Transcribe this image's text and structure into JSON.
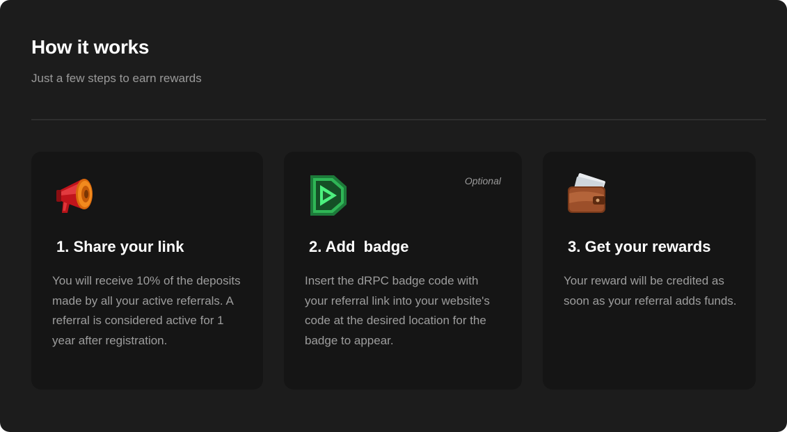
{
  "section": {
    "title": "How it works",
    "subtitle": "Just a few steps to earn rewards"
  },
  "steps": [
    {
      "number": "1.",
      "title": "Share your link",
      "body": "You will receive 10% of the deposits made by all your active referrals. A referral is considered active for 1 year after registration.",
      "icon": "megaphone-icon"
    },
    {
      "number": "2.",
      "title": "Add  badge",
      "body": "Insert the dRPC badge code with your referral link into your website's code at the desired location for the badge to appear.",
      "icon": "drpc-badge-icon",
      "tag": "Optional"
    },
    {
      "number": "3.",
      "title": "Get your rewards",
      "body": "Your reward will be credited as soon as your referral adds funds.",
      "icon": "wallet-icon"
    }
  ],
  "colors": {
    "panel_bg": "#1c1c1c",
    "card_bg": "#151515",
    "text_primary": "#ffffff",
    "text_secondary": "#9d9d9d",
    "accent_green": "#3ddc6a",
    "accent_orange": "#f07a14"
  }
}
